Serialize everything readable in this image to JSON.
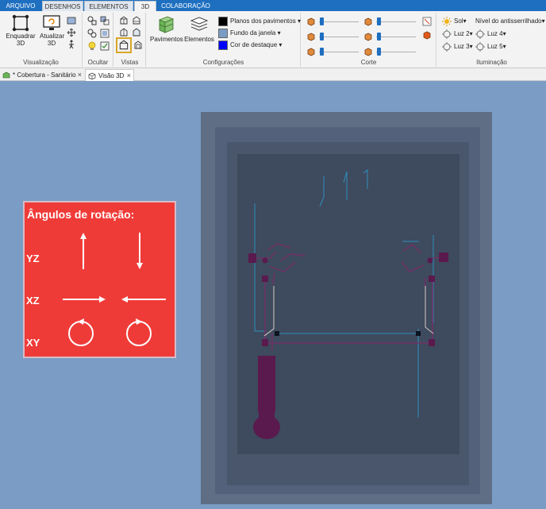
{
  "tabs": [
    {
      "label": "ARQUIVO"
    },
    {
      "label": "DESENHOS"
    },
    {
      "label": "ELEMENTOS"
    },
    {
      "label": "3D"
    },
    {
      "label": "COLABORAÇÃO"
    }
  ],
  "ribbon": {
    "visualizacao": {
      "label": "Visualização",
      "enquadrar": "Enquadrar\n3D",
      "atualizar": "Atualizar\n3D"
    },
    "ocultar": {
      "label": "Ocultar"
    },
    "vistas": {
      "label": "Vistas"
    },
    "configuracoes": {
      "label": "Configurações",
      "pavimentos": "Pavimentos",
      "elementos": "Elementos",
      "planos": "Planos dos pavimentos",
      "fundo": "Fundo da janela",
      "destaque": "Cor de destaque",
      "planos_color": "#000000",
      "fundo_color": "#7b9cc4",
      "destaque_color": "#0000ff"
    },
    "corte": {
      "label": "Corte"
    },
    "iluminacao": {
      "label": "Iluminação",
      "sol": "Sol",
      "luz2": "Luz 2",
      "luz3": "Luz 3",
      "nivel": "Nível do antisserrilhado",
      "luz4": "Luz 4",
      "luz5": "Luz 5"
    }
  },
  "doctabs": [
    {
      "label": "* Cobertura - Sanitário"
    },
    {
      "label": "Visão 3D"
    }
  ],
  "rotation_panel": {
    "title": "Ângulos de rotação:",
    "axes": [
      "YZ",
      "XZ",
      "XY"
    ]
  },
  "colors": {
    "accent": "#1e6fc0",
    "viewport_bg": "#7b9cc4",
    "panel_red": "#ef3b38"
  }
}
